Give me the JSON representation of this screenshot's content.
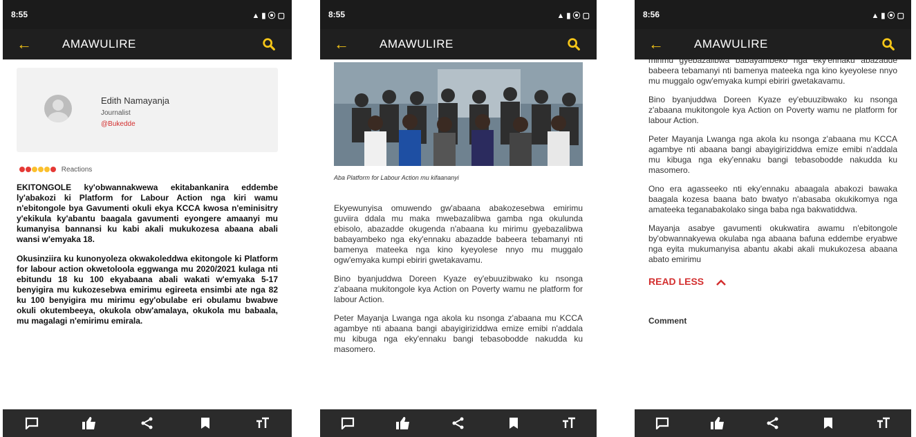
{
  "app": {
    "title": "AMAWULIRE",
    "accent": "#f5c518",
    "bar_color": "#1f1f1f"
  },
  "screens": [
    {
      "status_time": "8:55",
      "status_icons": "▲ ▮ ⦿ ▢",
      "author": {
        "name": "Edith  Namayanja",
        "role": "Journalist",
        "source": "@Bukedde"
      },
      "reactions_label": "Reactions",
      "paragraphs": [
        "EKITONGOLE ky'obwannakwewa ekitabankanira eddembe ly'abakozi ki Platform for Labour Action nga kiri wamu n'ebitongole bya Gavumenti okuli ekya KCCA kwosa n'eminisitry y'ekikula ky'abantu baagala gavumenti eyongere amaanyi mu kumanyisa bannansi ku kabi akali mukukozesa abaana abali wansi w'emyaka 18.",
        "Okusinziira ku kunonyoleza okwakoleddwa ekitongole ki Platform for labour action okwetoloola eggwanga mu 2020/2021 kulaga nti ebitundu 18 ku 100 ekyabaana abali wakati w'emyaka 5-17 benyigira mu kukozesebwa emirimu egireeta ensimbi ate nga 82 ku 100 benyigira mu mirimu egy'obulabe eri obulamu bwabwe okuli okutembeeya, okukola obw'amalaya, okukola mu babaala, mu magalagi n'emirimu emirala."
      ]
    },
    {
      "status_time": "8:55",
      "status_icons": "▲ ▮ ⦿ ▢",
      "caption": "Aba Platform for Labour Action mu kifaananyi",
      "paragraphs": [
        "Ekyewunyisa omuwendo gw'abaana abakozesebwa emirimu guviira ddala mu maka mwebazalibwa gamba nga okulunda ebisolo, abazadde okugenda n'abaana ku mirimu gyebazalibwa babayambeko nga eky'ennaku abazadde babeera tebamanyi nti bamenya mateeka nga kino kyeyolese nnyo mu muggalo ogw'emyaka kumpi ebiriri gwetakavamu.",
        "Bino byanjuddwa Doreen Kyaze ey'ebuuzibwako ku nsonga z'abaana mukitongole kya Action on Poverty wamu ne platform for labour Action.",
        "Peter Mayanja Lwanga nga akola ku nsonga z'abaana mu KCCA agambye nti abaana bangi abayigiriziddwa emize emibi n'addala mu kibuga nga eky'ennaku bangi tebasobodde nakudda ku masomero."
      ]
    },
    {
      "status_time": "8:56",
      "status_icons": "▲ ▮ ⦿ ▢",
      "paragraphs": [
        "mirimu gyebazalibwa babayambeko nga eky'ennaku abazadde babeera tebamanyi nti bamenya mateeka nga kino kyeyolese nnyo mu muggalo ogw'emyaka kumpi ebiriri gwetakavamu.",
        "Bino byanjuddwa Doreen Kyaze ey'ebuuzibwako ku nsonga z'abaana mukitongole kya Action on Poverty wamu ne platform for labour Action.",
        "Peter Mayanja Lwanga nga akola ku nsonga z'abaana mu KCCA agambye nti abaana bangi abayigiriziddwa emize emibi n'addala mu kibuga nga eky'ennaku bangi tebasobodde nakudda ku masomero.",
        "Ono era agasseeko nti eky'ennaku abaagala abakozi bawaka baagala kozesa baana bato bwatyo n'abasaba okukikomya nga amateeka teganabakolako singa baba nga bakwatiddwa.",
        "Mayanja asabye gavumenti okukwatira awamu n'ebitongole by'obwannakyewa okulaba nga abaana bafuna eddembe eryabwe nga eyita mukumanyisa abantu akabi akali mukukozesa abaana abato emirimu"
      ],
      "read_less": "READ LESS",
      "comment_label": "Comment"
    }
  ],
  "bottom_icons": [
    "comment-icon",
    "like-icon",
    "share-icon",
    "bookmark-icon",
    "text-size-icon"
  ]
}
